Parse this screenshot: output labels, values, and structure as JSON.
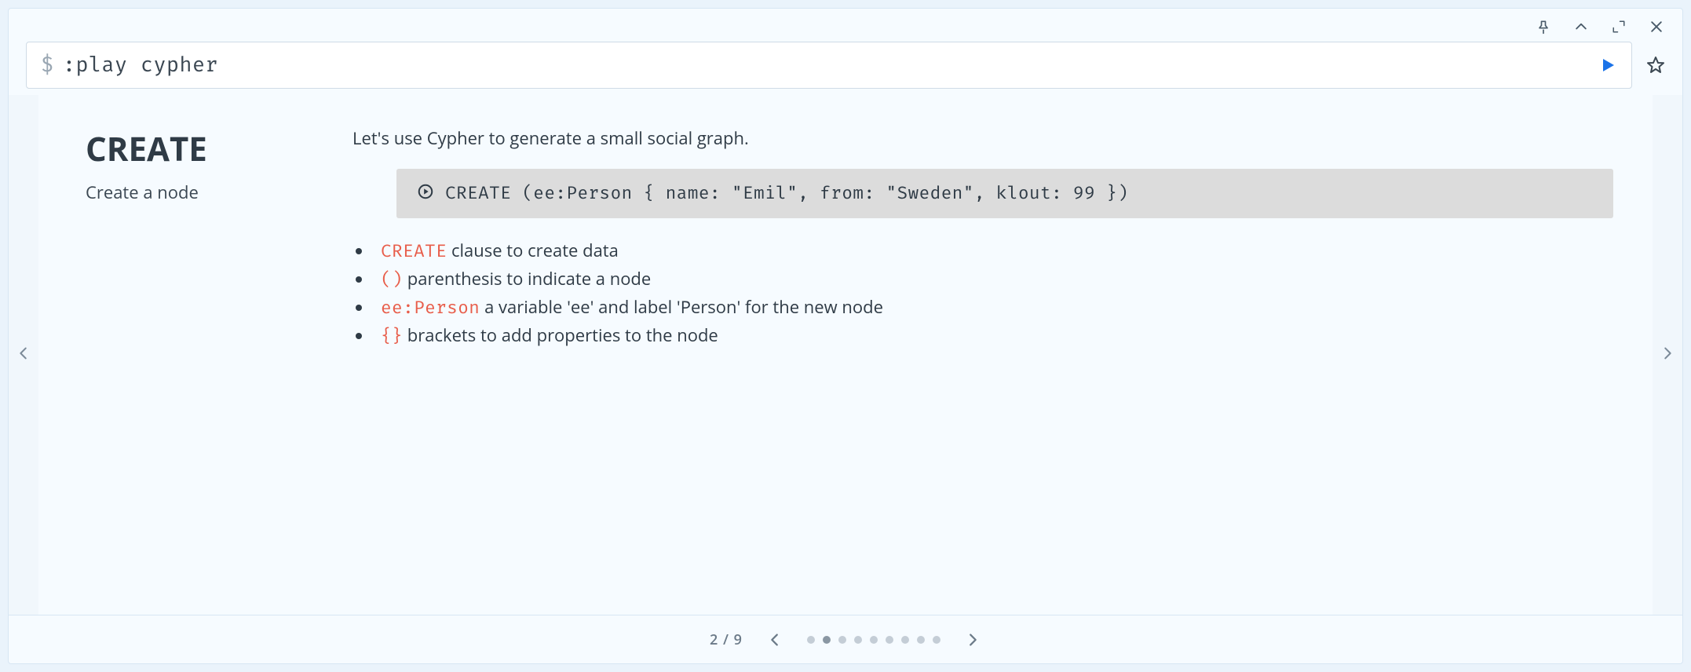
{
  "command": {
    "prompt": "$",
    "text": ":play cypher"
  },
  "slide": {
    "title": "CREATE",
    "subtitle": "Create a node",
    "intro": "Let's use Cypher to generate a small social graph.",
    "code": "CREATE (ee:Person { name: \"Emil\", from: \"Sweden\", klout: 99 })",
    "bullets": [
      {
        "code": "CREATE",
        "text": " clause to create data"
      },
      {
        "code": "()",
        "text": " parenthesis to indicate a node"
      },
      {
        "code": "ee:Person",
        "text": " a variable 'ee' and label 'Person' for the new node"
      },
      {
        "code": "{}",
        "text": " brackets to add properties to the node"
      }
    ]
  },
  "pagination": {
    "current": 2,
    "total": 9,
    "label": "2 / 9"
  }
}
